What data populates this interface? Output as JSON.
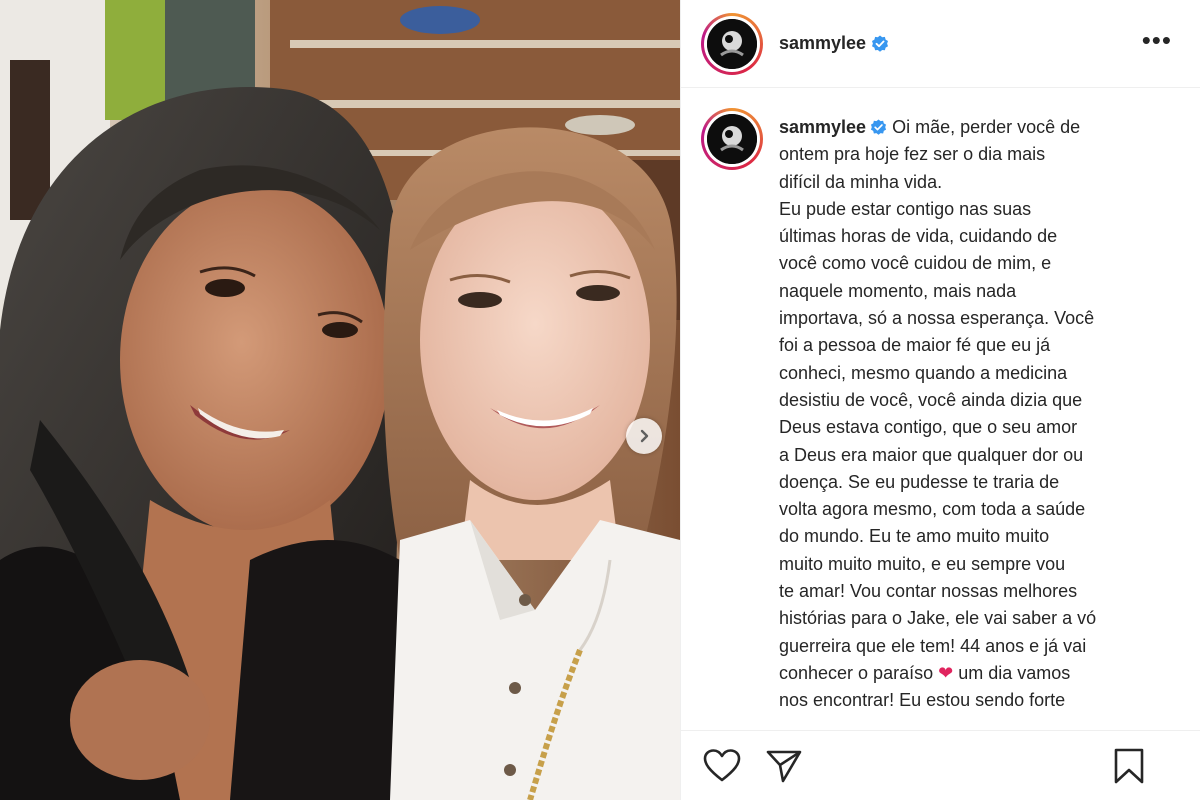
{
  "post": {
    "username": "sammylee",
    "verified": true,
    "caption_lines": [
      "Oi mãe, perder você de",
      "ontem pra hoje fez ser o dia mais",
      "difícil da minha vida.",
      "Eu pude estar contigo nas suas",
      "últimas horas de vida, cuidando de",
      "você como você cuidou de mim, e",
      "naquele momento, mais nada",
      "importava, só a nossa esperança. Você",
      "foi a pessoa de maior fé que eu já",
      "conheci, mesmo quando a medicina",
      "desistiu de você, você ainda dizia que",
      "Deus estava contigo, que o seu amor",
      "a Deus era maior que qualquer dor ou",
      "doença. Se eu pudesse te traria de",
      "volta agora mesmo, com toda a saúde",
      "do mundo. Eu te amo muito muito",
      "muito muito muito, e eu sempre vou",
      "te amar! Vou contar nossas melhores",
      "histórias para o Jake, ele vai saber a vó",
      "guerreira que ele tem! 44 anos e já vai",
      "conhecer o paraíso ❤ um dia vamos",
      "nos encontrar! Eu estou sendo forte"
    ]
  },
  "icons": {
    "more": "more-options-icon",
    "verified": "verified-badge-icon",
    "next": "chevron-right-icon",
    "like": "heart-outline-icon",
    "share": "paper-plane-icon",
    "save": "bookmark-icon"
  },
  "colors": {
    "verified": "#3897f0",
    "border": "#efefef",
    "text": "#262626",
    "heart": "#e0245e"
  }
}
